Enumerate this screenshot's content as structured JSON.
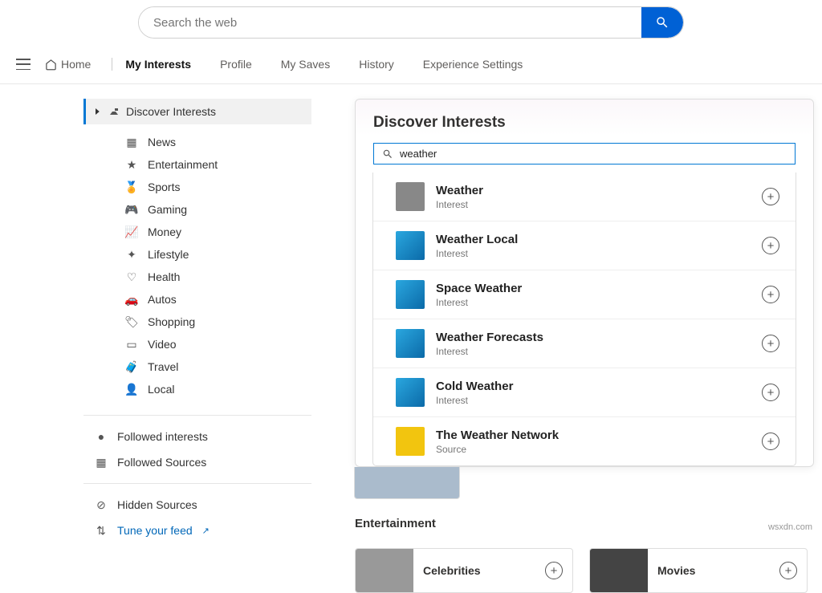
{
  "search": {
    "placeholder": "Search the web"
  },
  "nav": {
    "home": "Home",
    "myInterests": "My Interests",
    "profile": "Profile",
    "mySaves": "My Saves",
    "history": "History",
    "expSettings": "Experience Settings"
  },
  "sidebar": {
    "discover": "Discover Interests",
    "cats": {
      "news": "News",
      "entertainment": "Entertainment",
      "sports": "Sports",
      "gaming": "Gaming",
      "money": "Money",
      "lifestyle": "Lifestyle",
      "health": "Health",
      "autos": "Autos",
      "shopping": "Shopping",
      "video": "Video",
      "travel": "Travel",
      "local": "Local"
    },
    "followedInterests": "Followed interests",
    "followedSources": "Followed Sources",
    "hiddenSources": "Hidden Sources",
    "tuneFeed": "Tune your feed"
  },
  "main": {
    "title": "Discover Interests",
    "searchValue": "weather",
    "results": [
      {
        "title": "Weather",
        "sub": "Interest"
      },
      {
        "title": "Weather Local",
        "sub": "Interest"
      },
      {
        "title": "Space Weather",
        "sub": "Interest"
      },
      {
        "title": "Weather Forecasts",
        "sub": "Interest"
      },
      {
        "title": "Cold Weather",
        "sub": "Interest"
      },
      {
        "title": "The Weather Network",
        "sub": "Source"
      }
    ],
    "entSection": "Entertainment",
    "celebrities": "Celebrities",
    "movies": "Movies"
  },
  "footer": "wsxdn.com"
}
